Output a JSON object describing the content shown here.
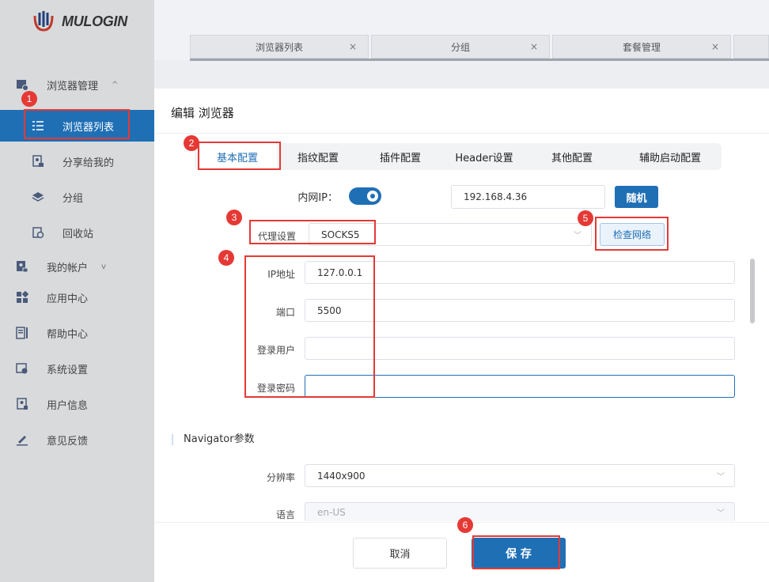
{
  "app": {
    "logo_text": "MULOGIN"
  },
  "sidebar": {
    "items": [
      {
        "label": "浏览器管理",
        "icon": "browser-manage-icon",
        "chevron": "^"
      },
      {
        "label": "浏览器列表",
        "icon": "list-icon"
      },
      {
        "label": "分享给我的",
        "icon": "share-icon"
      },
      {
        "label": "分组",
        "icon": "layers-icon"
      },
      {
        "label": "回收站",
        "icon": "recycle-icon"
      },
      {
        "label": "我的帐户",
        "icon": "account-icon",
        "chevron": "v"
      },
      {
        "label": "应用中心",
        "icon": "apps-icon"
      },
      {
        "label": "帮助中心",
        "icon": "help-icon"
      },
      {
        "label": "系统设置",
        "icon": "settings-icon"
      },
      {
        "label": "用户信息",
        "icon": "user-info-icon"
      },
      {
        "label": "意见反馈",
        "icon": "feedback-icon"
      }
    ]
  },
  "top_tabs": [
    {
      "label": "浏览器列表",
      "close": "×"
    },
    {
      "label": "分组",
      "close": "×"
    },
    {
      "label": "套餐管理",
      "close": "×"
    }
  ],
  "modal": {
    "title": "编辑 浏览器",
    "tabs": [
      "基本配置",
      "指纹配置",
      "插件配置",
      "Header设置",
      "其他配置",
      "辅助启动配置"
    ],
    "lan_ip": {
      "label": "内网IP：",
      "value": "192.168.4.36",
      "random_button": "随机"
    },
    "proxy": {
      "label": "代理设置",
      "value": "SOCKS5",
      "check_button": "检查网络"
    },
    "fields": {
      "ip": {
        "label": "IP地址",
        "value": "127.0.0.1"
      },
      "port": {
        "label": "端口",
        "value": "5500"
      },
      "user": {
        "label": "登录用户",
        "value": ""
      },
      "password": {
        "label": "登录密码",
        "value": ""
      }
    },
    "navigator": {
      "section_title": "Navigator参数",
      "resolution": {
        "label": "分辨率",
        "value": "1440x900"
      },
      "language": {
        "label": "语言",
        "value": "en-US"
      }
    },
    "footer": {
      "cancel": "取消",
      "save": "保 存"
    }
  },
  "annotations": [
    "1",
    "2",
    "3",
    "4",
    "5",
    "6"
  ],
  "colors": {
    "primary": "#1f6fb5",
    "annotation": "#e53935"
  }
}
